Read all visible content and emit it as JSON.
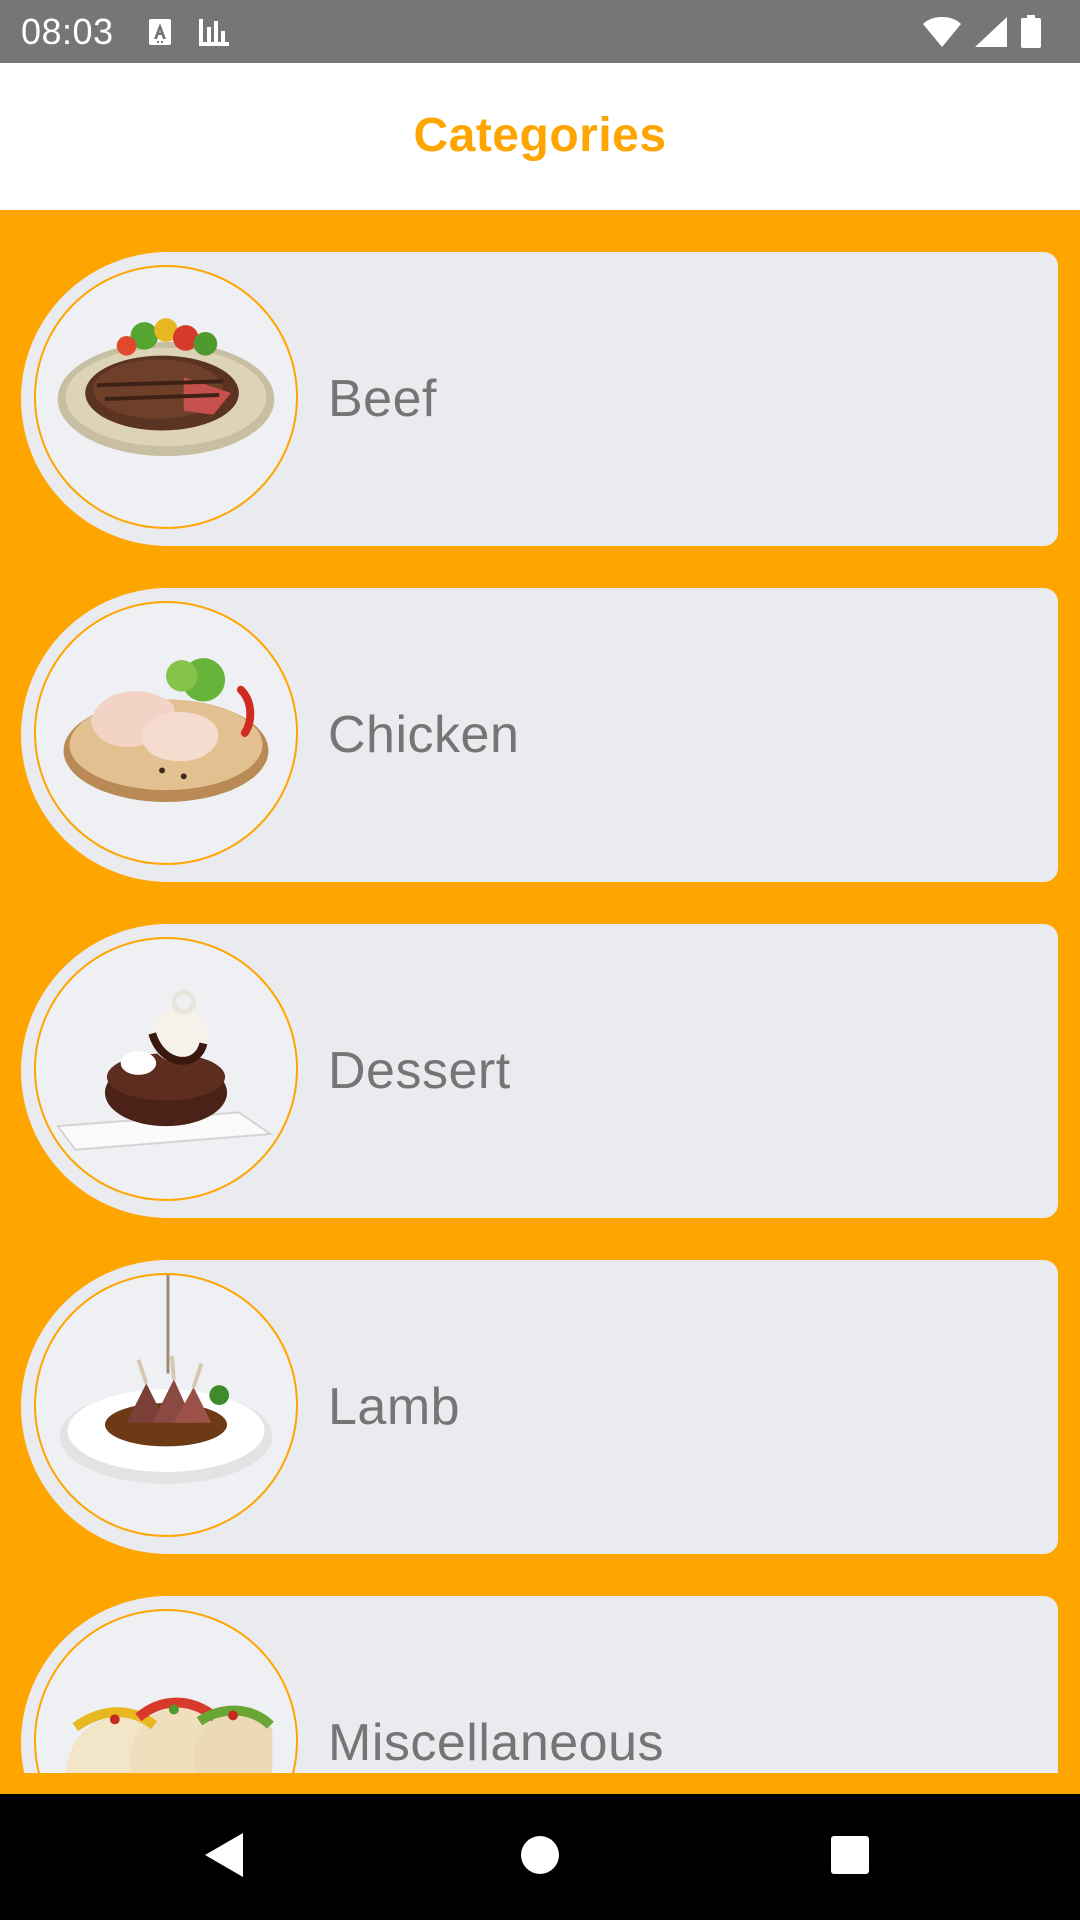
{
  "status_bar": {
    "time": "08:03",
    "left_icons": [
      "font-icon",
      "bar-chart-icon"
    ],
    "right_icons": [
      "wifi-icon",
      "signal-icon",
      "battery-icon"
    ]
  },
  "app_bar": {
    "title": "Categories"
  },
  "colors": {
    "accent": "#ffa500",
    "card_background": "#e9ebee",
    "label_text": "#757575",
    "status_bar": "#767676",
    "nav_bar": "#000000"
  },
  "categories": [
    {
      "label": "Beef",
      "image": "beef-dish-icon"
    },
    {
      "label": "Chicken",
      "image": "chicken-dish-icon"
    },
    {
      "label": "Dessert",
      "image": "dessert-dish-icon"
    },
    {
      "label": "Lamb",
      "image": "lamb-dish-icon"
    },
    {
      "label": "Miscellaneous",
      "image": "tacos-dish-icon"
    }
  ],
  "nav_bar": {
    "buttons": [
      "back-icon",
      "home-icon",
      "recents-icon"
    ]
  }
}
